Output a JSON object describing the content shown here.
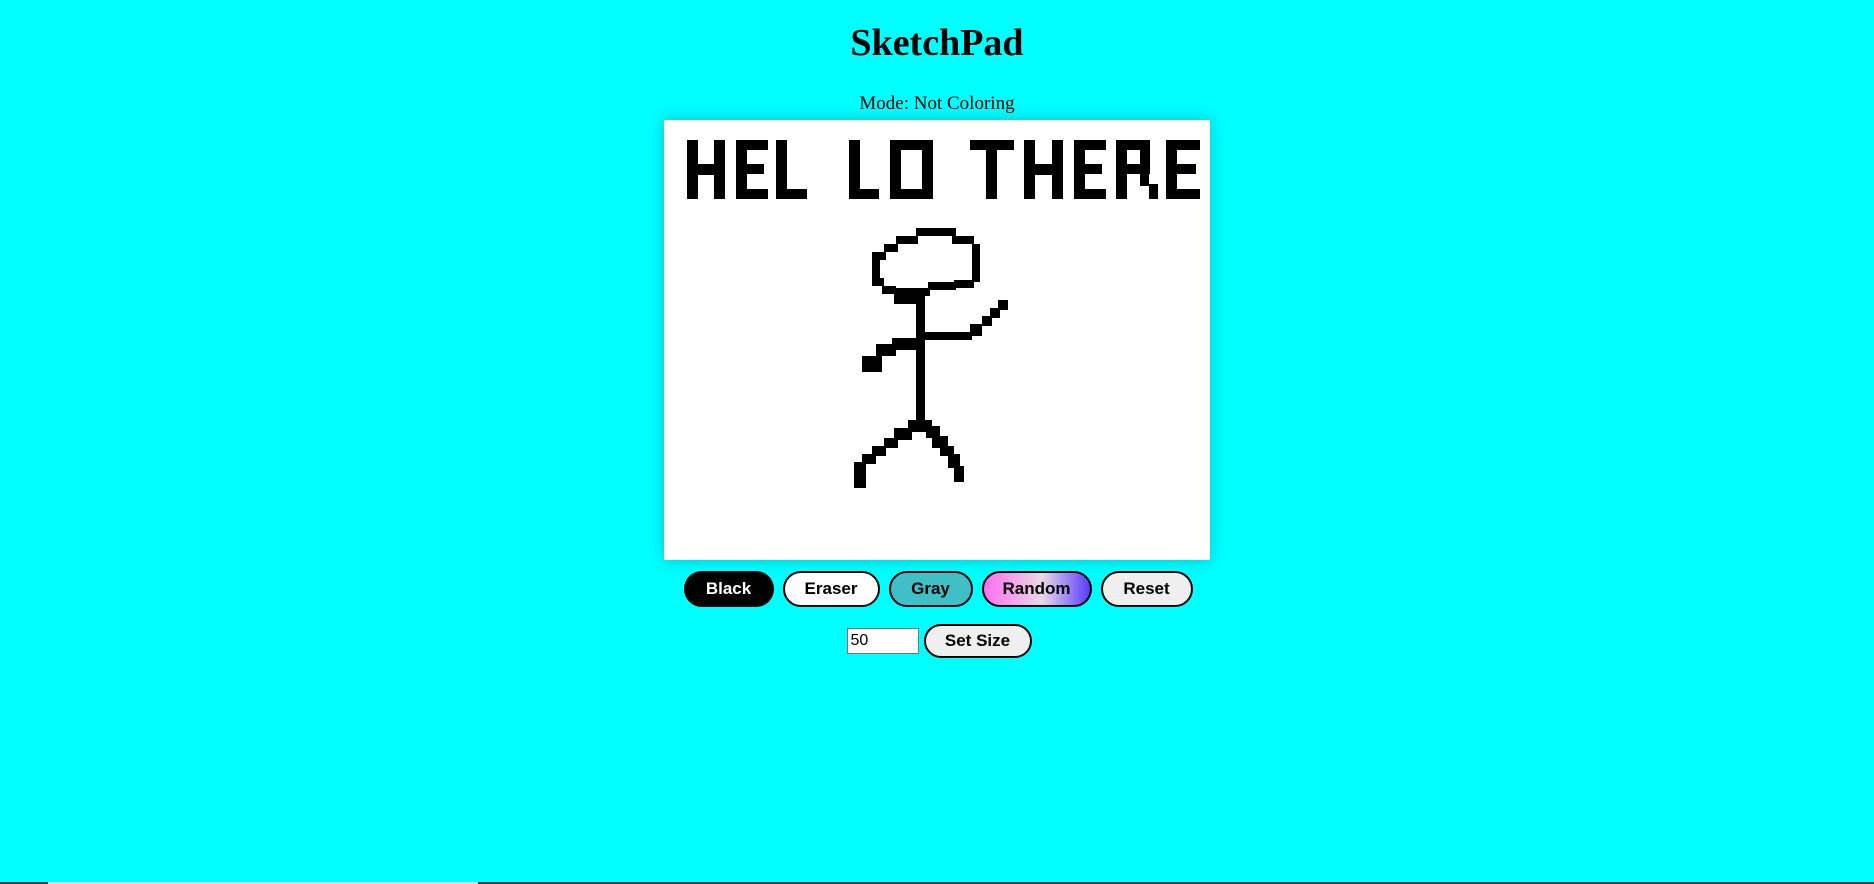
{
  "app": {
    "title": "SketchPad",
    "mode_text": "Mode: Not Coloring"
  },
  "canvas": {
    "drawing_text": "HELLO THERE"
  },
  "buttons": {
    "black": "Black",
    "eraser": "Eraser",
    "gray": "Gray",
    "random": "Random",
    "reset": "Reset"
  },
  "size": {
    "value": "50",
    "set_label": "Set Size"
  },
  "colors": {
    "background": "#00ffff",
    "canvas": "#ffffff",
    "ink": "#000000",
    "gray_button": "#3fbfc6"
  }
}
